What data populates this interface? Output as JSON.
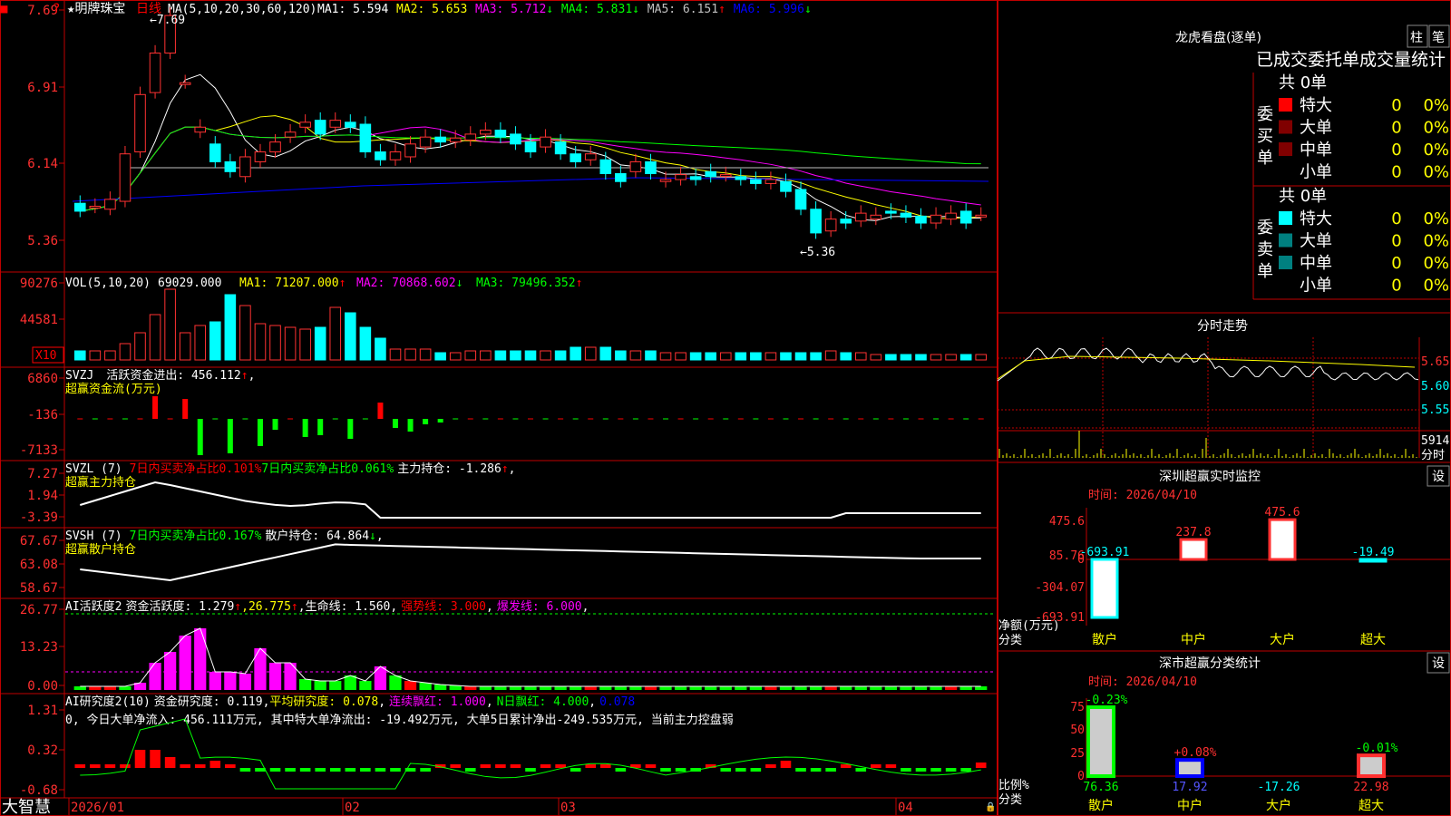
{
  "app": {
    "name": "大智慧",
    "stock_name": "明牌珠宝",
    "period": "日线"
  },
  "main_chart": {
    "ma_header": "MA(5,10,20,30,60,120)",
    "ma_items": [
      {
        "label": "MA1",
        "value": "5.594",
        "arrow": "",
        "color": "#ffffff"
      },
      {
        "label": "MA2",
        "value": "5.653",
        "arrow": "",
        "color": "#ffff00"
      },
      {
        "label": "MA3",
        "value": "5.712",
        "arrow": "↓",
        "color": "#ff00ff"
      },
      {
        "label": "MA4",
        "value": "5.831",
        "arrow": "↓",
        "color": "#00ff00"
      },
      {
        "label": "MA5",
        "value": "6.151",
        "arrow": "↑",
        "color": "#c0c0c0"
      },
      {
        "label": "MA6",
        "value": "5.996",
        "arrow": "↓",
        "color": "#0000ff"
      }
    ],
    "y_ticks": [
      "7.69",
      "6.91",
      "6.14",
      "5.36"
    ],
    "high_label": "7.69",
    "low_label": "5.36"
  },
  "vol_panel": {
    "label": "VOL(5,10,20)",
    "value": "69029.000",
    "ma1": "MA1: 71207.000",
    "ma1_arrow": "↑",
    "ma2": "MA2: 70868.602",
    "ma2_arrow": "↓",
    "ma3": "MA3: 79496.352",
    "ma3_arrow": "↑",
    "y_ticks": [
      "90276",
      "44581"
    ],
    "unit": "X10"
  },
  "svzj_panel": {
    "label": "SVZJ",
    "desc": "活跃资金进出: 456.112",
    "arrow": "↑",
    "subtitle": "超赢资金流(万元)",
    "y_ticks": [
      "6860",
      "-136",
      "-7133"
    ]
  },
  "svzl_panel": {
    "label": "SVZL (7)",
    "t1": "7日内买卖净占比0.101%",
    "t2": "7日内买卖净占比0.061%",
    "t3": "主力持仓: -1.286",
    "arrow": "↑",
    "subtitle": "超赢主力持仓",
    "y_ticks": [
      "7.27",
      "1.94",
      "-3.39"
    ]
  },
  "svsh_panel": {
    "label": "SVSH (7)",
    "t1": "7日内买卖净占比0.167%",
    "t2": "散户持仓: 64.864",
    "arrow": "↓",
    "subtitle": "超赢散户持仓",
    "y_ticks": [
      "67.67",
      "63.08",
      "58.67"
    ]
  },
  "ai_active_panel": {
    "label": "AI活跃度2",
    "t1": "资金活跃度: 1.279",
    "t2": "26.775",
    "t3": "生命线: 1.560",
    "t4": "强势线: 3.000",
    "t5": "爆发线: 6.000",
    "y_ticks": [
      "26.77",
      "13.23",
      "0.00"
    ]
  },
  "ai_research_panel": {
    "label": "AI研究度2(10)",
    "t1": "资金研究度: 0.119",
    "t2": "平均研究度: 0.078",
    "t3": "连续飘红: 1.000",
    "t4": "N日飘红: 4.000",
    "t5": "0.078",
    "summary": "0, 今日大单净流入: 456.111万元, 其中特大单净流出: -19.492万元, 大单5日累计净出-249.535万元, 当前主力控盘弱",
    "y_ticks": [
      "1.31",
      "0.32",
      "-0.68"
    ]
  },
  "x_axis": {
    "labels": [
      "2026/01",
      "02",
      "03",
      "04"
    ]
  },
  "right_panel": {
    "dragon_title": "龙虎看盘(逐单)",
    "btn_zhu": "柱",
    "btn_bi": "笔",
    "stats_title": "已成交委托单成交量统计",
    "buy_group": {
      "label": "委买单",
      "total": "共 0单",
      "rows": [
        {
          "name": "特大",
          "count": "0",
          "pct": "0%",
          "color": "#ff0000"
        },
        {
          "name": "大单",
          "count": "0",
          "pct": "0%",
          "color": "#800000"
        },
        {
          "name": "中单",
          "count": "0",
          "pct": "0%",
          "color": "#800000"
        },
        {
          "name": "小单",
          "count": "0",
          "pct": "0%",
          "color": ""
        }
      ]
    },
    "sell_group": {
      "label": "委卖单",
      "total": "共 0单",
      "rows": [
        {
          "name": "特大",
          "count": "0",
          "pct": "0%",
          "color": "#00ffff"
        },
        {
          "name": "大单",
          "count": "0",
          "pct": "0%",
          "color": "#008080"
        },
        {
          "name": "中单",
          "count": "0",
          "pct": "0%",
          "color": "#008080"
        },
        {
          "name": "小单",
          "count": "0",
          "pct": "0%",
          "color": ""
        }
      ]
    },
    "intraday": {
      "title": "分时走势",
      "price_ticks": [
        "5.65",
        "5.60",
        "5.55"
      ],
      "vol_tick": "5914",
      "vol_unit": "分时"
    },
    "sz_monitor": {
      "title": "深圳超赢实时监控",
      "btn": "设",
      "time": "时间: 2026/04/10",
      "y_ticks": [
        "475.6",
        "85.76",
        "0",
        "-304.07",
        "-693.91"
      ],
      "axis_label_1": "净额(万元)",
      "axis_label_2": "分类",
      "bars": [
        {
          "cat": "散户",
          "value": "-693.91"
        },
        {
          "cat": "中户",
          "value": "237.8"
        },
        {
          "cat": "大户",
          "value": "475.6"
        },
        {
          "cat": "超大",
          "value": "-19.49"
        }
      ]
    },
    "sz_class": {
      "title": "深市超赢分类统计",
      "btn": "设",
      "time": "时间: 2026/04/10",
      "y_ticks": [
        "75",
        "50",
        "25",
        "0"
      ],
      "axis_label_1": "比例%",
      "axis_label_2": "分类",
      "bars": [
        {
          "cat": "散户",
          "top": "-0.23%",
          "value": "76.36"
        },
        {
          "cat": "中户",
          "top": "+0.08%",
          "value": "17.92"
        },
        {
          "cat": "大户",
          "top": "",
          "value": "-17.26"
        },
        {
          "cat": "超大",
          "top": "-0.01%",
          "value": "22.98"
        }
      ]
    }
  }
}
